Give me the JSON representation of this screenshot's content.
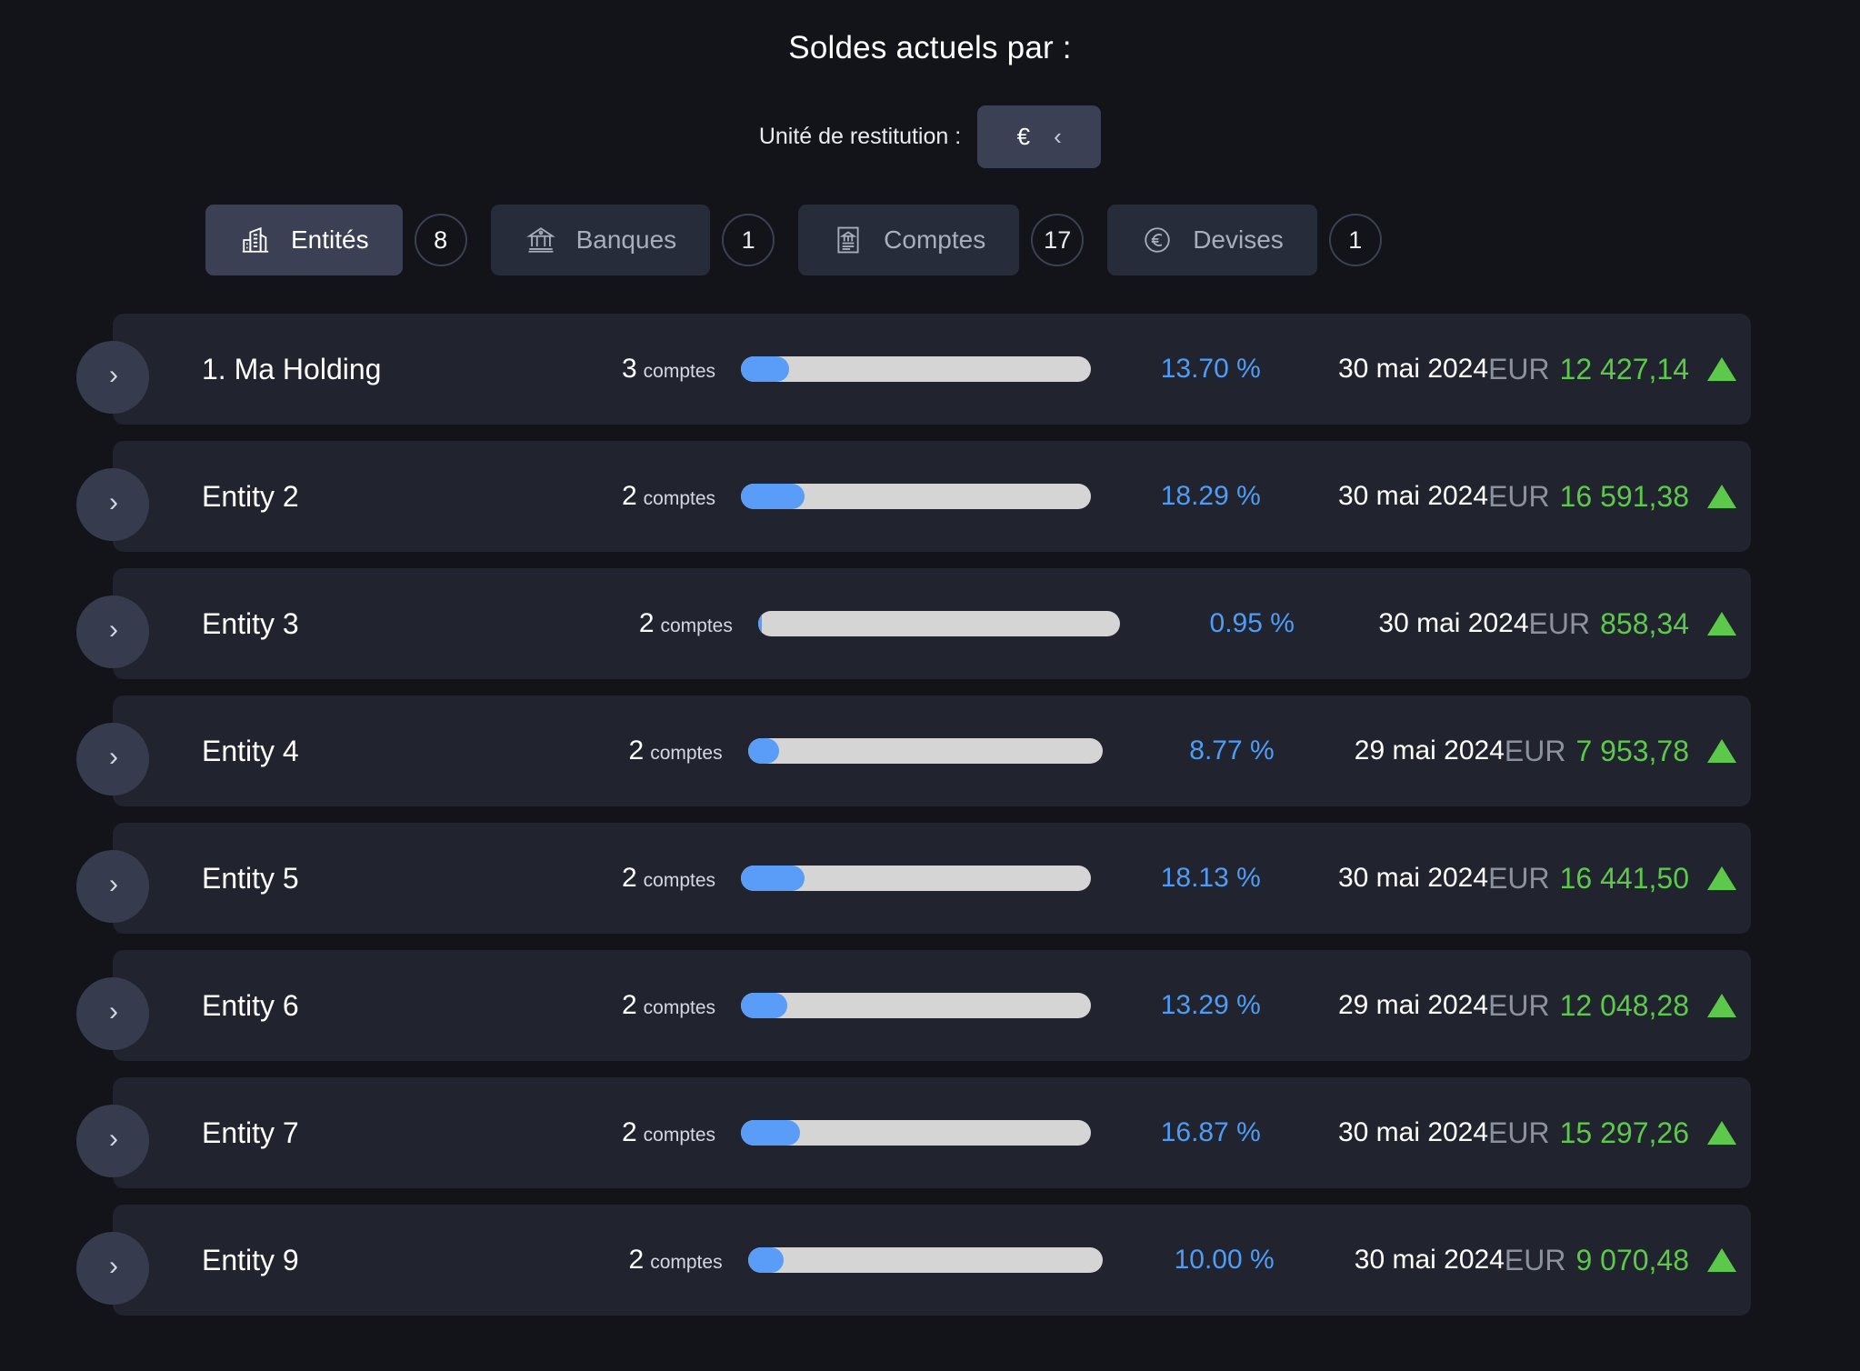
{
  "header": {
    "title": "Soldes actuels par :",
    "unit_label": "Unité de restitution :",
    "unit_value": "€",
    "unit_chevron": "‹"
  },
  "tabs": [
    {
      "label": "Entités",
      "badge": "8",
      "icon": "buildings-icon",
      "active": true
    },
    {
      "label": "Banques",
      "badge": "1",
      "icon": "bank-icon",
      "active": false
    },
    {
      "label": "Comptes",
      "badge": "17",
      "icon": "account-sheet-icon",
      "active": false
    },
    {
      "label": "Devises",
      "badge": "1",
      "icon": "euro-circle-icon",
      "active": false
    }
  ],
  "labels": {
    "accounts_word": "comptes",
    "expand_chevron": "›"
  },
  "colors": {
    "page_background": "#121419",
    "row_background": "#21242f",
    "tab_active": "#3b4054",
    "tab_inactive": "#272c3a",
    "bar_fill": "#5a9df8",
    "bar_track": "#d5d5d5",
    "percent_text": "#4f9cf5",
    "amount_positive": "#5cc94a",
    "currency_text": "#8c919e"
  },
  "rows": [
    {
      "name": "1. Ma Holding",
      "accounts": "3",
      "percent": "13.70 %",
      "percent_value": 13.7,
      "date": "30 mai 2024",
      "currency": "EUR",
      "amount": "12 427,14",
      "trend": "up"
    },
    {
      "name": "Entity 2",
      "accounts": "2",
      "percent": "18.29 %",
      "percent_value": 18.29,
      "date": "30 mai 2024",
      "currency": "EUR",
      "amount": "16 591,38",
      "trend": "up"
    },
    {
      "name": "Entity 3",
      "accounts": "2",
      "percent": "0.95 %",
      "percent_value": 0.95,
      "date": "30 mai 2024",
      "currency": "EUR",
      "amount": "858,34",
      "trend": "up"
    },
    {
      "name": "Entity 4",
      "accounts": "2",
      "percent": "8.77 %",
      "percent_value": 8.77,
      "date": "29 mai 2024",
      "currency": "EUR",
      "amount": "7 953,78",
      "trend": "up"
    },
    {
      "name": "Entity 5",
      "accounts": "2",
      "percent": "18.13 %",
      "percent_value": 18.13,
      "date": "30 mai 2024",
      "currency": "EUR",
      "amount": "16 441,50",
      "trend": "up"
    },
    {
      "name": "Entity 6",
      "accounts": "2",
      "percent": "13.29 %",
      "percent_value": 13.29,
      "date": "29 mai 2024",
      "currency": "EUR",
      "amount": "12 048,28",
      "trend": "up"
    },
    {
      "name": "Entity 7",
      "accounts": "2",
      "percent": "16.87 %",
      "percent_value": 16.87,
      "date": "30 mai 2024",
      "currency": "EUR",
      "amount": "15 297,26",
      "trend": "up"
    },
    {
      "name": "Entity 9",
      "accounts": "2",
      "percent": "10.00 %",
      "percent_value": 10.0,
      "date": "30 mai 2024",
      "currency": "EUR",
      "amount": "9 070,48",
      "trend": "up"
    }
  ]
}
